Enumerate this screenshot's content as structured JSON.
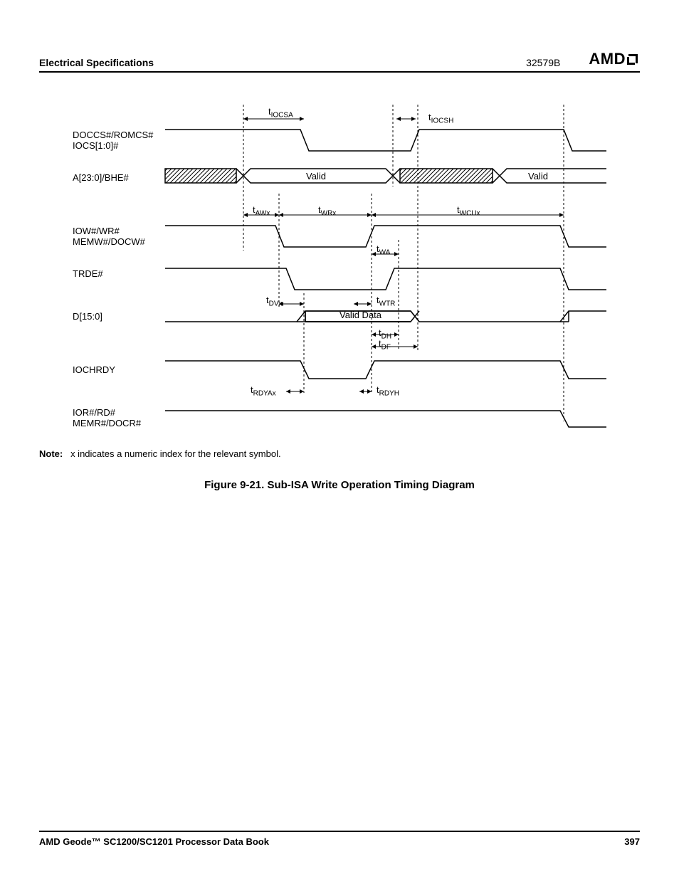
{
  "header": {
    "section": "Electrical Specifications",
    "docnum": "32579B",
    "logo": "AMD"
  },
  "note_prefix": "Note:",
  "note_text": "x indicates a numeric index for the relevant symbol.",
  "caption": "Figure 9-21.  Sub-ISA Write Operation Timing Diagram",
  "footer": {
    "title": "AMD Geode™ SC1200/SC1201 Processor Data Book",
    "page": "397"
  },
  "signals": {
    "s1a": "DOCCS#/ROMCS#",
    "s1b": "IOCS[1:0]#",
    "s2": "A[23:0]/BHE#",
    "s3a": "IOW#/WR#",
    "s3b": "MEMW#/DOCW#",
    "s4": "TRDE#",
    "s5": "D[15:0]",
    "s6": "IOCHRDY",
    "s7a": "IOR#/RD#",
    "s7b": "MEMR#/DOCR#"
  },
  "tlabels": {
    "iocsa": "IOCSA",
    "iocsh": "IOCSH",
    "awx": "AWx",
    "wrx": "WRx",
    "wcux": "WCUx",
    "wa": "WA",
    "dvx": "DVx",
    "wtr": "WTR",
    "dh": "DH",
    "df": "DF",
    "rdyax": "RDYAx",
    "rdyh": "RDYH"
  },
  "text": {
    "valid": "Valid",
    "valid_data": "Valid Data"
  }
}
